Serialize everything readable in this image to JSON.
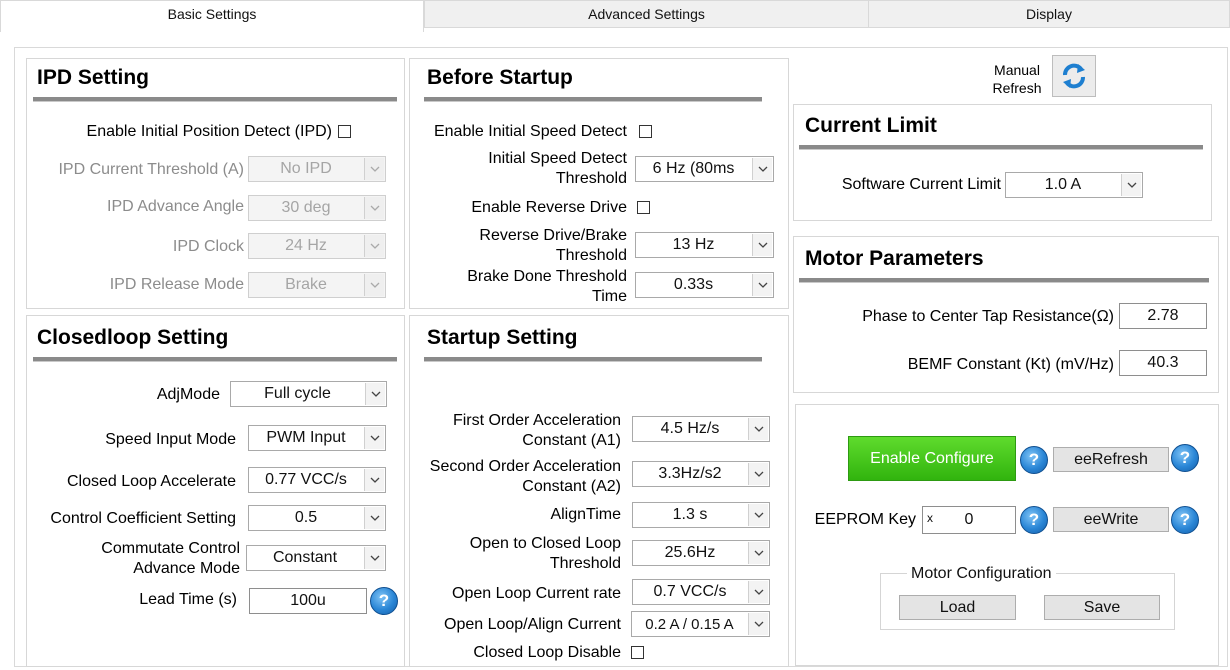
{
  "tabs": [
    "Basic Settings",
    "Advanced Settings",
    "Display"
  ],
  "ipd": {
    "title": "IPD Setting",
    "enable_label": "Enable Initial Position Detect (IPD)",
    "rows": [
      {
        "label": "IPD Current Threshold (A)",
        "value": "No IPD"
      },
      {
        "label": "IPD Advance Angle",
        "value": "30 deg"
      },
      {
        "label": "IPD Clock",
        "value": "24 Hz"
      },
      {
        "label": "IPD Release Mode",
        "value": "Brake"
      }
    ]
  },
  "before_startup": {
    "title": "Before Startup",
    "enable_speed_label": "Enable Initial Speed Detect",
    "speed_thr_label1": "Initial Speed Detect",
    "speed_thr_label2": "Threshold",
    "speed_thr_value": "6 Hz (80ms",
    "enable_reverse_label": "Enable Reverse Drive",
    "rev_label1": "Reverse Drive/Brake",
    "rev_label2": "Threshold",
    "rev_value": "13 Hz",
    "brake_label1": "Brake Done Threshold",
    "brake_label2": "Time",
    "brake_value": "0.33s"
  },
  "closedloop": {
    "title": "Closedloop Setting",
    "adj_label": "AdjMode",
    "adj_value": "Full cycle",
    "speed_label": "Speed Input Mode",
    "speed_value": "PWM Input",
    "accel_label": "Closed Loop Accelerate",
    "accel_value": "0.77 VCC/s",
    "coef_label": "Control Coefficient Setting",
    "coef_value": "0.5",
    "comm_label1": "Commutate Control",
    "comm_label2": "Advance Mode",
    "comm_value": "Constant",
    "lead_label": "Lead Time (s)",
    "lead_value": "100u"
  },
  "startup": {
    "title": "Startup Setting",
    "a1_label1": "First Order Acceleration",
    "a1_label2": "Constant (A1)",
    "a1_value": "4.5 Hz/s",
    "a2_label1": "Second Order Acceleration",
    "a2_label2": "Constant (A2)",
    "a2_value": "3.3Hz/s2",
    "align_label": "AlignTime",
    "align_value": "1.3 s",
    "open_label1": "Open to Closed Loop",
    "open_label2": "Threshold",
    "open_value": "25.6Hz",
    "olcr_label": "Open Loop Current rate",
    "olcr_value": "0.7 VCC/s",
    "olac_label": "Open Loop/Align Current",
    "olac_value": "0.2 A / 0.15 A",
    "cld_label": "Closed Loop Disable"
  },
  "refresh": {
    "line1": "Manual",
    "line2": "Refresh"
  },
  "current_limit": {
    "title": "Current Limit",
    "label": "Software Current Limit",
    "value": "1.0 A"
  },
  "motor": {
    "title": "Motor Parameters",
    "res_label": "Phase to Center Tap Resistance(Ω)",
    "res_value": "2.78",
    "bemf_label": "BEMF Constant (Kt) (mV/Hz)",
    "bemf_value": "40.3"
  },
  "config": {
    "enable_label": "Enable Configure",
    "eerefresh_label": "eeRefresh",
    "key_label": "EEPROM Key",
    "key_prefix": "x",
    "key_value": "0",
    "eewrite_label": "eeWrite",
    "group_title": "Motor Configuration",
    "load_label": "Load",
    "save_label": "Save"
  },
  "help_glyph": "?",
  "colors": {
    "accent_green": "#3cc316",
    "help_blue": "#2a86d6"
  }
}
